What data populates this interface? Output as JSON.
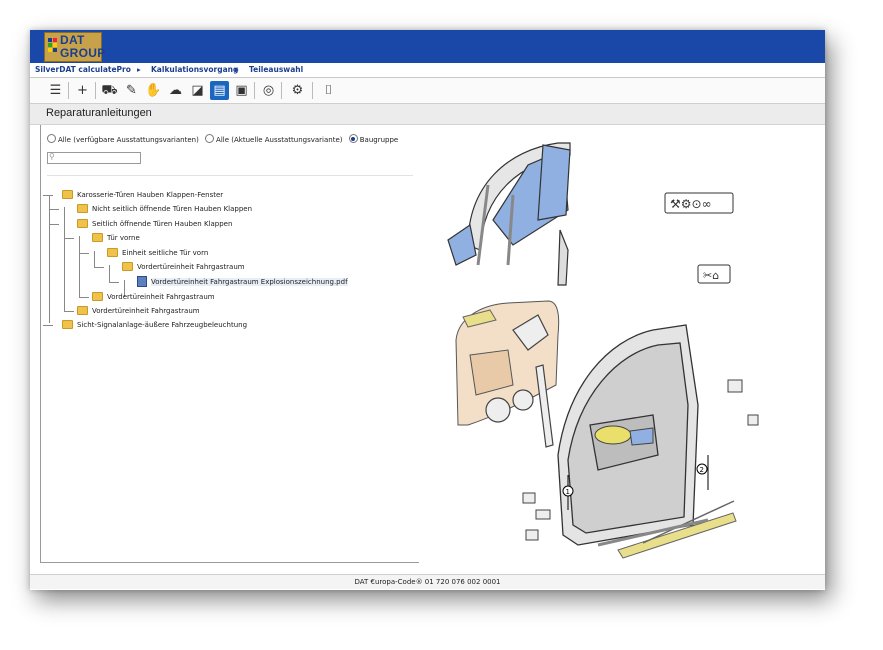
{
  "brand": {
    "line1": "DAT",
    "line2": "GROUP"
  },
  "breadcrumb": {
    "items": [
      "SilverDAT calculatePro",
      "Kalkulationsvorgang",
      "Teileauswahl"
    ],
    "separator": "▸"
  },
  "toolbar": {
    "buttons": [
      {
        "icon": "menu-icon",
        "glyph": "☰"
      },
      {
        "icon": "add-position-icon",
        "glyph": "+"
      },
      {
        "icon": "vehicle-icon",
        "glyph": "⛟"
      },
      {
        "icon": "paint-icon",
        "glyph": "✎"
      },
      {
        "icon": "hand-icon",
        "glyph": "✋"
      },
      {
        "icon": "hail-icon",
        "glyph": "☁"
      },
      {
        "icon": "glass-icon",
        "glyph": "◪"
      },
      {
        "icon": "repair-manual-icon",
        "glyph": "▤"
      },
      {
        "icon": "camera-video-icon",
        "glyph": "▣"
      },
      {
        "icon": "tire-icon",
        "glyph": "◎"
      },
      {
        "icon": "settings-icon",
        "glyph": "⚙"
      },
      {
        "icon": "camera-icon",
        "glyph": "⌷"
      }
    ],
    "active_index": 7
  },
  "page": {
    "title": "Reparaturanleitungen"
  },
  "filters": {
    "options": [
      {
        "label": "Alle (verfügbare Ausstattungsvarianten)",
        "checked": false
      },
      {
        "label": "Alle (Aktuelle Ausstattungsvariante)",
        "checked": false
      },
      {
        "label": "Baugruppe",
        "checked": true
      }
    ],
    "search": {
      "value": "",
      "placeholder": ""
    }
  },
  "tree": [
    {
      "label": "Karosserie-Türen Hauben Klappen-Fenster",
      "level": 0,
      "type": "folder"
    },
    {
      "label": "Nicht seitlich öffnende Türen Hauben Klappen",
      "level": 1,
      "type": "folder"
    },
    {
      "label": "Seitlich öffnende Türen Hauben Klappen",
      "level": 1,
      "type": "folder"
    },
    {
      "label": "Tür vorne",
      "level": 2,
      "type": "folder"
    },
    {
      "label": "Einheit seitliche Tür vorn",
      "level": 3,
      "type": "folder"
    },
    {
      "label": "Vordertüreinheit Fahrgastraum",
      "level": 4,
      "type": "folder"
    },
    {
      "label": "Vordertüreinheit Fahrgastraum Explosionszeichnung.pdf",
      "level": 5,
      "type": "pdf",
      "selected": true
    },
    {
      "label": "Vordertüreinheit Fahrgastraum",
      "level": 2,
      "type": "folder"
    },
    {
      "label": "Vordertüreinheit Fahrgastraum",
      "level": 1,
      "type": "folder"
    },
    {
      "label": "Sicht-Signalanlage-äußere Fahrzeugbeleuchtung",
      "level": 0,
      "type": "folder"
    }
  ],
  "drawing": {
    "marker1": "1",
    "marker2": "2"
  },
  "status": {
    "text": "DAT €uropa-Code® 01 720 076 002 0001"
  }
}
